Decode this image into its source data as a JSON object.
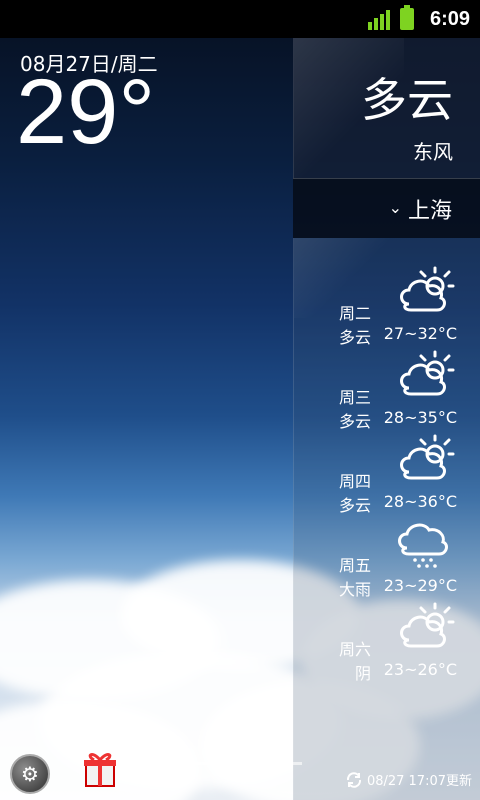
{
  "status_bar": {
    "time": "6:09"
  },
  "header": {
    "date": "08月27日/周二",
    "temperature": "29°"
  },
  "current": {
    "condition": "多云",
    "wind": "东风",
    "city": "上海",
    "city_chevron": "⌄"
  },
  "forecast": [
    {
      "weekday": "周二",
      "condition": "多云",
      "range": "27~32°C",
      "icon": "partly-cloudy-icon"
    },
    {
      "weekday": "周三",
      "condition": "多云",
      "range": "28~35°C",
      "icon": "partly-cloudy-icon"
    },
    {
      "weekday": "周四",
      "condition": "多云",
      "range": "28~36°C",
      "icon": "partly-cloudy-icon"
    },
    {
      "weekday": "周五",
      "condition": "大雨",
      "range": "23~29°C",
      "icon": "heavy-rain-icon"
    },
    {
      "weekday": "周六",
      "condition": "阴",
      "range": "23~26°C",
      "icon": "partly-cloudy-icon"
    }
  ],
  "footer": {
    "update_text": "08/27 17:07更新",
    "settings_icon": "gear-icon",
    "gift_icon": "gift-icon",
    "refresh_icon": "refresh-icon"
  }
}
